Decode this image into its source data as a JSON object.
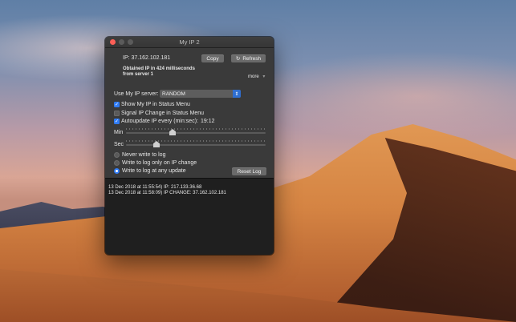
{
  "window": {
    "title": "My IP 2"
  },
  "ip": {
    "display": "IP: 37.162.102.181",
    "copy_label": "Copy",
    "refresh_label": "Refresh",
    "info_line1": "Obtained IP in 424 milliseconds",
    "info_line2": "from server 1",
    "more_label": "more"
  },
  "server": {
    "label": "Use My IP server:",
    "selected": "RANDOM"
  },
  "options": {
    "show_status_menu": {
      "label": "Show My IP in Status Menu",
      "checked": true
    },
    "signal_change": {
      "label": "Signal IP Change in Status Menu",
      "checked": false
    },
    "autoupdate": {
      "label": "Autoupdate IP every (min:sec):",
      "checked": true,
      "value": "19:12"
    }
  },
  "sliders": {
    "min": {
      "label": "Min"
    },
    "sec": {
      "label": "Sec"
    }
  },
  "logging": {
    "never": "Never write to log",
    "on_change": "Write to log only on IP change",
    "any_update": "Write to log at any update",
    "selected": "any_update",
    "reset_label": "Reset Log"
  },
  "log_lines": [
    "13 Dec 2018 at 11:55:54) IP: 217.133.36.68",
    "13 Dec 2018 at 11:58:09) IP CHANGE: 37.162.102.181"
  ],
  "colors": {
    "accent": "#2f7bf5",
    "close": "#fc5f57"
  }
}
